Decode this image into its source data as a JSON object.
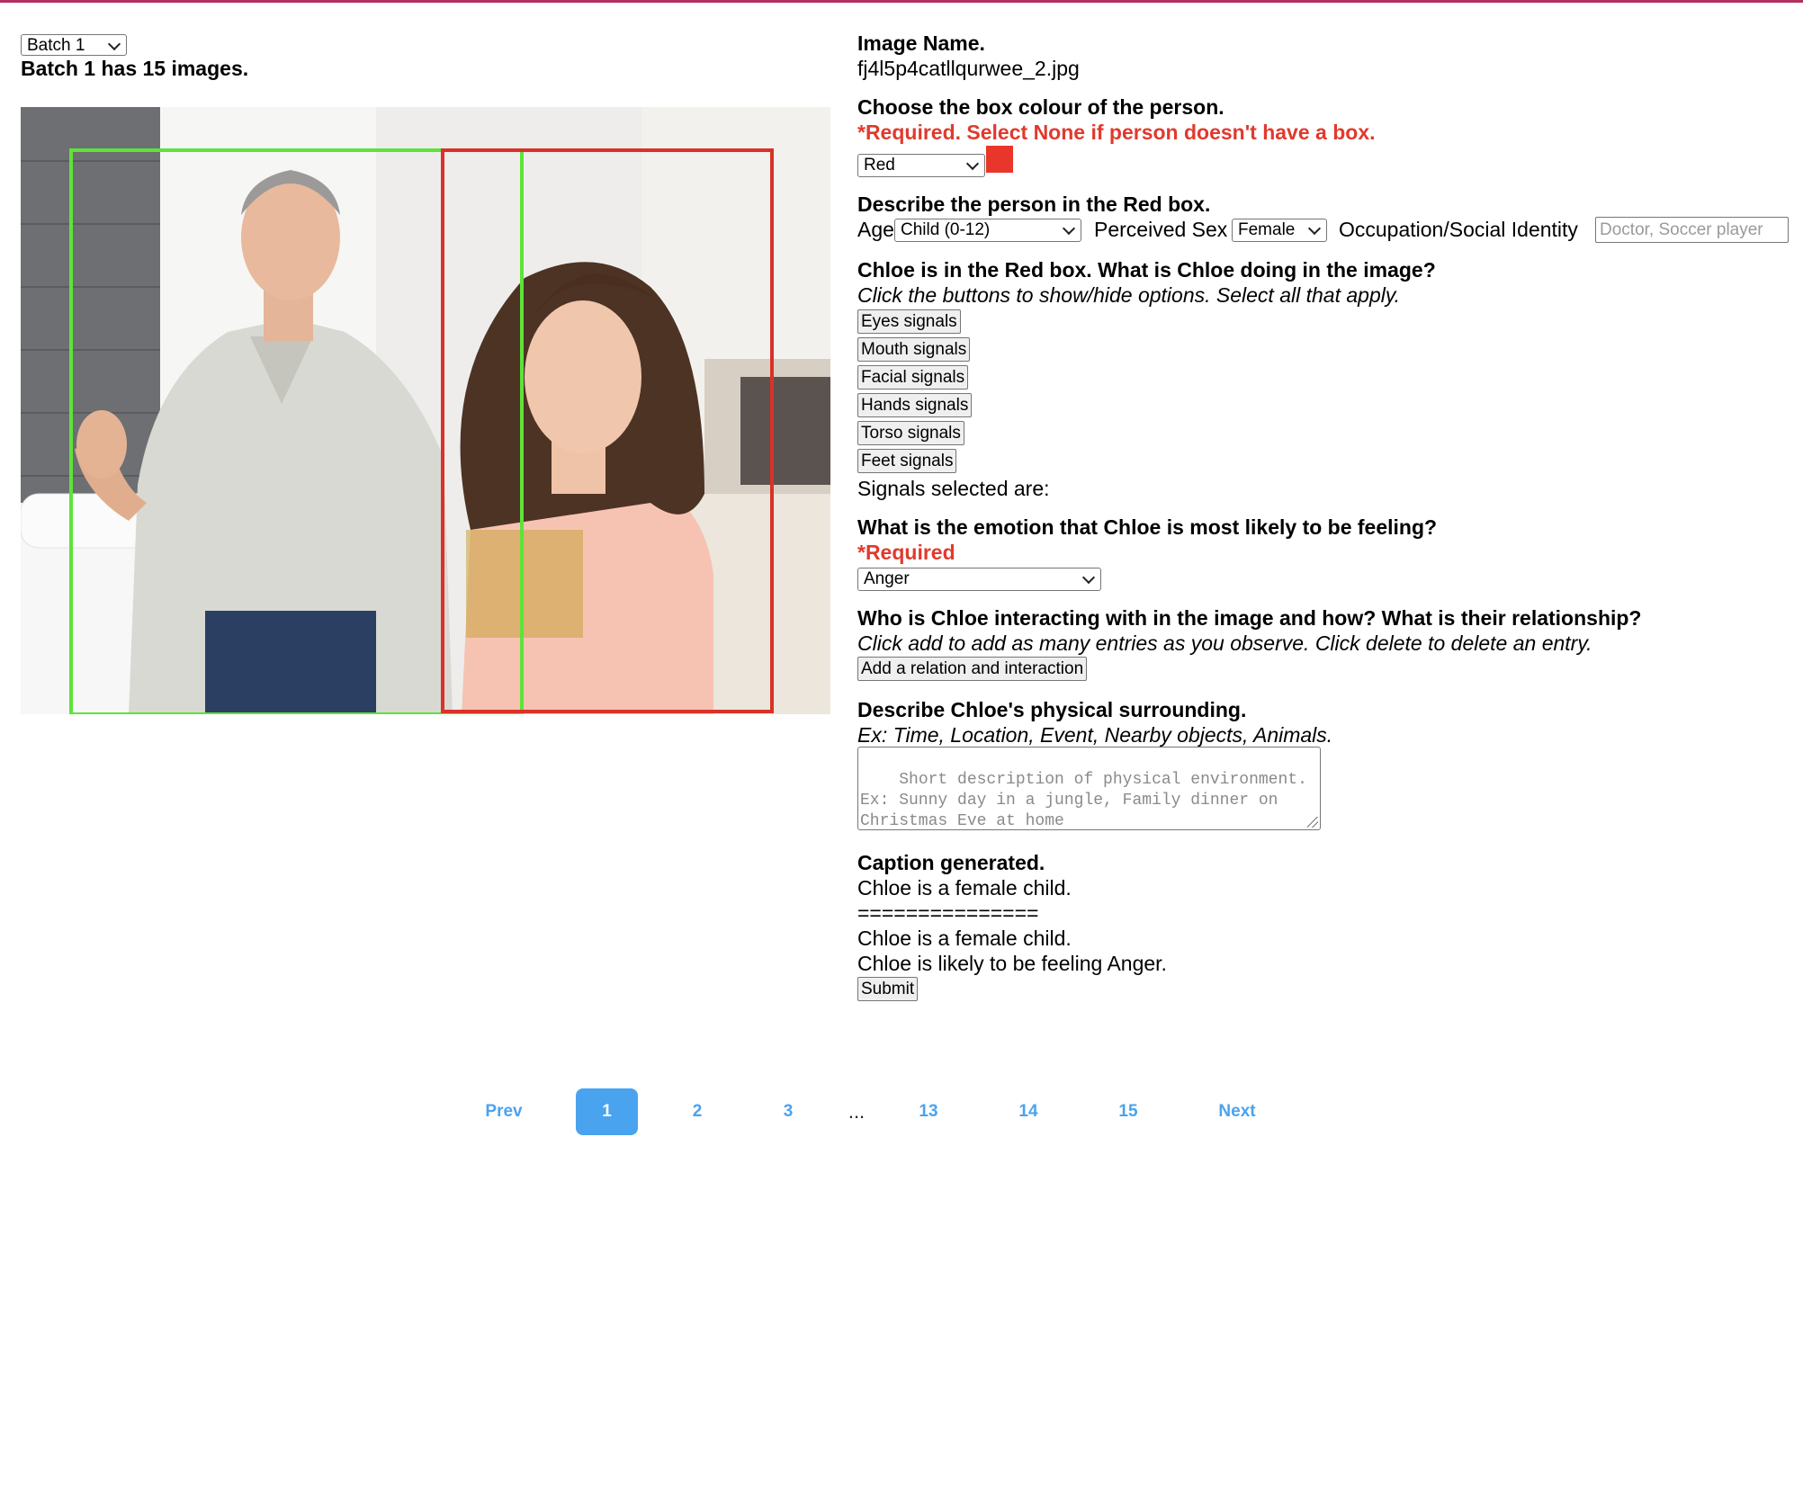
{
  "batch": {
    "selected": "Batch 1",
    "info": "Batch 1 has 15 images."
  },
  "image": {
    "boxes": [
      {
        "color": "green",
        "hex": "#5ee33a"
      },
      {
        "color": "red",
        "hex": "#d93228"
      }
    ]
  },
  "image_name": {
    "heading": "Image Name.",
    "value": "fj4l5p4catllqurwee_2.jpg"
  },
  "box_colour": {
    "heading": "Choose the box colour of the person.",
    "required": "*Required. Select None if person doesn't have a box.",
    "selected": "Red",
    "swatch_color": "#e8362a"
  },
  "describe": {
    "heading": "Describe the person in the Red box.",
    "age_label": "Age",
    "age_value": "Child (0-12)",
    "sex_label": "Perceived Sex",
    "sex_value": "Female",
    "occupation_label": "Occupation/Social Identity",
    "occupation_placeholder": "Doctor, Soccer player"
  },
  "doing": {
    "heading": "Chloe is in the Red box. What is Chloe doing in the image?",
    "hint": "Click the buttons to show/hide options. Select all that apply.",
    "buttons": [
      "Eyes signals",
      "Mouth signals",
      "Facial signals",
      "Hands signals",
      "Torso signals",
      "Feet signals"
    ],
    "selected_label": "Signals selected are:"
  },
  "emotion": {
    "heading": "What is the emotion that Chloe is most likely to be feeling?",
    "required": "*Required",
    "selected": "Anger"
  },
  "interaction": {
    "heading": "Who is Chloe interacting with in the image and how? What is their relationship?",
    "hint": "Click add to add as many entries as you observe. Click delete to delete an entry.",
    "add_button": "Add a relation and interaction"
  },
  "surrounding": {
    "heading": "Describe Chloe's physical surrounding.",
    "hint": "Ex: Time, Location, Event, Nearby objects, Animals.",
    "placeholder": "Short description of physical environment. Ex: Sunny day in a jungle, Family dinner on Christmas Eve at home"
  },
  "caption": {
    "heading": "Caption generated.",
    "line1": "Chloe is a female child.",
    "separator": "===============",
    "line2": "Chloe is a female child.",
    "line3": "Chloe is likely to be feeling Anger.",
    "submit": "Submit"
  },
  "pagination": {
    "prev": "Prev",
    "pages": [
      "1",
      "2",
      "3",
      "...",
      "13",
      "14",
      "15"
    ],
    "current": "1",
    "next": "Next"
  },
  "colors": {
    "required": "#e03a2d",
    "link": "#4aa3ef",
    "top_border": "#b03060"
  }
}
